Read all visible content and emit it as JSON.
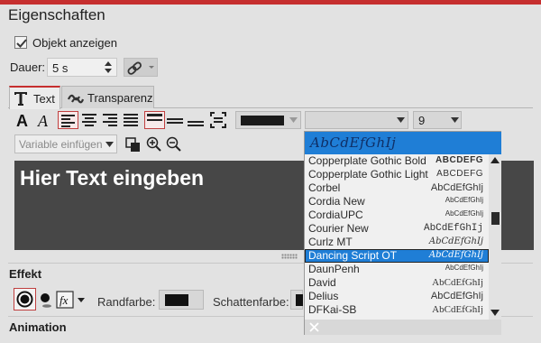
{
  "panel": {
    "title": "Eigenschaften"
  },
  "object": {
    "show_label": "Objekt anzeigen",
    "show_checked": true
  },
  "duration": {
    "label": "Dauer:",
    "value": "5 s"
  },
  "tabs": [
    {
      "label": "Text",
      "active": true
    },
    {
      "label": "Transparenz",
      "active": false
    }
  ],
  "toolbar": {
    "font_size": "9",
    "text_color": "#1a1a1a",
    "variable_placeholder": "Variable einfügen"
  },
  "editor": {
    "text": "Hier Text eingeben",
    "background": "#474747"
  },
  "effect": {
    "section_label": "Effekt",
    "border_color_label": "Randfarbe:",
    "shadow_color_label": "Schattenfarbe:",
    "border_color": "#111111"
  },
  "animation": {
    "section_label": "Animation"
  },
  "font_dropdown": {
    "preview_text": "AbCdEfGhIj",
    "selected": "Dancing Script OT",
    "items": [
      {
        "name": "Copperplate Gothic Bold",
        "preview": "ABCDEFG"
      },
      {
        "name": "Copperplate Gothic Light",
        "preview": "ABCDEFG"
      },
      {
        "name": "Corbel",
        "preview": "AbCdEfGhIj"
      },
      {
        "name": "Cordia New",
        "preview": "AbCdEfGhIj"
      },
      {
        "name": "CordiaUPC",
        "preview": "AbCdEfGhIj"
      },
      {
        "name": "Courier New",
        "preview": "AbCdEfGhIj"
      },
      {
        "name": "Curlz MT",
        "preview": "AbCdEfGhIj"
      },
      {
        "name": "Dancing Script OT",
        "preview": "AbCdEfGhIj"
      },
      {
        "name": "DaunPenh",
        "preview": "AbCdEfGhIj"
      },
      {
        "name": "David",
        "preview": "AbCdEfGhIj"
      },
      {
        "name": "Delius",
        "preview": "AbCdEfGhIj"
      },
      {
        "name": "DFKai-SB",
        "preview": "AbCdEfGhIj"
      }
    ]
  },
  "colors": {
    "accent": "#c62f2f",
    "selection": "#1f7ed6"
  }
}
